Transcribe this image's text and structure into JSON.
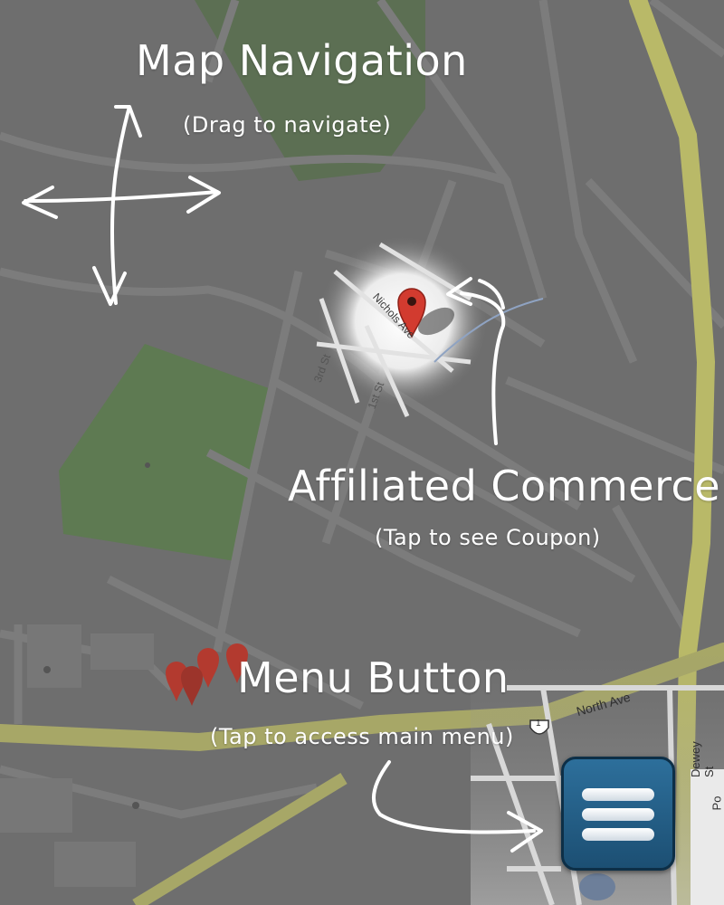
{
  "annotations": {
    "map_nav": {
      "title": "Map Navigation",
      "hint": "(Drag to navigate)"
    },
    "commerce": {
      "title": "Affiliated Commerce",
      "hint": "(Tap to see Coupon)"
    },
    "menu": {
      "title": "Menu Button",
      "hint": "(Tap to access main menu)"
    }
  },
  "streets": {
    "nichols": "Nichols Ave",
    "north": "North Ave",
    "dewey": "Dewey St",
    "third": "3rd St",
    "first": "1st St",
    "po": "Po",
    "route": "1"
  },
  "colors": {
    "map_bg": "#6e6e6e",
    "highway": "#c8c86a",
    "park": "#5e7a52",
    "pin": "#d23b2f",
    "menu_button": "#245f88"
  }
}
